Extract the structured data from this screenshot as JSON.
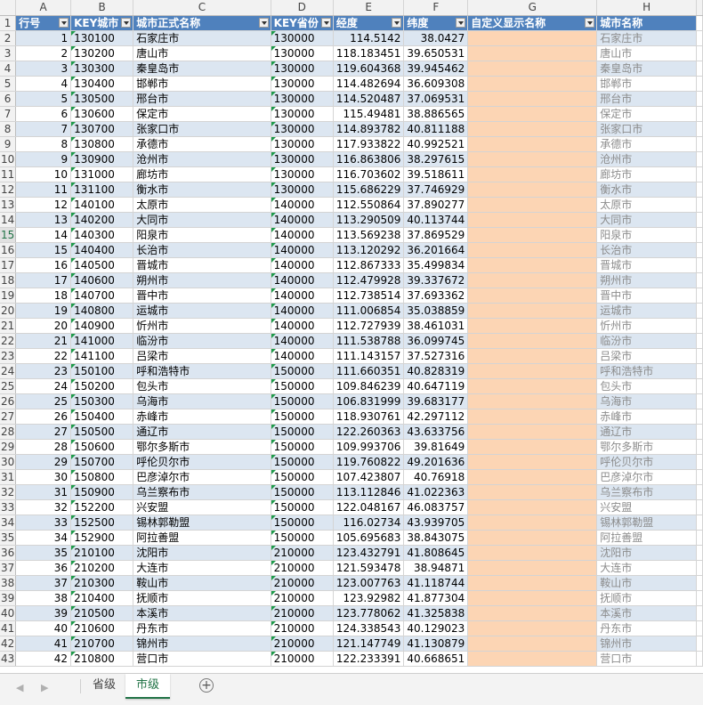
{
  "columns": [
    "A",
    "B",
    "C",
    "D",
    "E",
    "F",
    "G",
    "H"
  ],
  "headers": [
    "行号",
    "KEY城市",
    "城市正式名称",
    "KEY省份",
    "经度",
    "纬度",
    "自定义显示名称",
    "城市名称"
  ],
  "header_row_number": 1,
  "active_row_number": 15,
  "rows": [
    [
      1,
      "130100",
      "石家庄市",
      "130000",
      "114.5142",
      "38.0427",
      "",
      "石家庄市"
    ],
    [
      2,
      "130200",
      "唐山市",
      "130000",
      "118.183451",
      "39.650531",
      "",
      "唐山市"
    ],
    [
      3,
      "130300",
      "秦皇岛市",
      "130000",
      "119.604368",
      "39.945462",
      "",
      "秦皇岛市"
    ],
    [
      4,
      "130400",
      "邯郸市",
      "130000",
      "114.482694",
      "36.609308",
      "",
      "邯郸市"
    ],
    [
      5,
      "130500",
      "邢台市",
      "130000",
      "114.520487",
      "37.069531",
      "",
      "邢台市"
    ],
    [
      6,
      "130600",
      "保定市",
      "130000",
      "115.49481",
      "38.886565",
      "",
      "保定市"
    ],
    [
      7,
      "130700",
      "张家口市",
      "130000",
      "114.893782",
      "40.811188",
      "",
      "张家口市"
    ],
    [
      8,
      "130800",
      "承德市",
      "130000",
      "117.933822",
      "40.992521",
      "",
      "承德市"
    ],
    [
      9,
      "130900",
      "沧州市",
      "130000",
      "116.863806",
      "38.297615",
      "",
      "沧州市"
    ],
    [
      10,
      "131000",
      "廊坊市",
      "130000",
      "116.703602",
      "39.518611",
      "",
      "廊坊市"
    ],
    [
      11,
      "131100",
      "衡水市",
      "130000",
      "115.686229",
      "37.746929",
      "",
      "衡水市"
    ],
    [
      12,
      "140100",
      "太原市",
      "140000",
      "112.550864",
      "37.890277",
      "",
      "太原市"
    ],
    [
      13,
      "140200",
      "大同市",
      "140000",
      "113.290509",
      "40.113744",
      "",
      "大同市"
    ],
    [
      14,
      "140300",
      "阳泉市",
      "140000",
      "113.569238",
      "37.869529",
      "",
      "阳泉市"
    ],
    [
      15,
      "140400",
      "长治市",
      "140000",
      "113.120292",
      "36.201664",
      "",
      "长治市"
    ],
    [
      16,
      "140500",
      "晋城市",
      "140000",
      "112.867333",
      "35.499834",
      "",
      "晋城市"
    ],
    [
      17,
      "140600",
      "朔州市",
      "140000",
      "112.479928",
      "39.337672",
      "",
      "朔州市"
    ],
    [
      18,
      "140700",
      "晋中市",
      "140000",
      "112.738514",
      "37.693362",
      "",
      "晋中市"
    ],
    [
      19,
      "140800",
      "运城市",
      "140000",
      "111.006854",
      "35.038859",
      "",
      "运城市"
    ],
    [
      20,
      "140900",
      "忻州市",
      "140000",
      "112.727939",
      "38.461031",
      "",
      "忻州市"
    ],
    [
      21,
      "141000",
      "临汾市",
      "140000",
      "111.538788",
      "36.099745",
      "",
      "临汾市"
    ],
    [
      22,
      "141100",
      "吕梁市",
      "140000",
      "111.143157",
      "37.527316",
      "",
      "吕梁市"
    ],
    [
      23,
      "150100",
      "呼和浩特市",
      "150000",
      "111.660351",
      "40.828319",
      "",
      "呼和浩特市"
    ],
    [
      24,
      "150200",
      "包头市",
      "150000",
      "109.846239",
      "40.647119",
      "",
      "包头市"
    ],
    [
      25,
      "150300",
      "乌海市",
      "150000",
      "106.831999",
      "39.683177",
      "",
      "乌海市"
    ],
    [
      26,
      "150400",
      "赤峰市",
      "150000",
      "118.930761",
      "42.297112",
      "",
      "赤峰市"
    ],
    [
      27,
      "150500",
      "通辽市",
      "150000",
      "122.260363",
      "43.633756",
      "",
      "通辽市"
    ],
    [
      28,
      "150600",
      "鄂尔多斯市",
      "150000",
      "109.993706",
      "39.81649",
      "",
      "鄂尔多斯市"
    ],
    [
      29,
      "150700",
      "呼伦贝尔市",
      "150000",
      "119.760822",
      "49.201636",
      "",
      "呼伦贝尔市"
    ],
    [
      30,
      "150800",
      "巴彦淖尔市",
      "150000",
      "107.423807",
      "40.76918",
      "",
      "巴彦淖尔市"
    ],
    [
      31,
      "150900",
      "乌兰察布市",
      "150000",
      "113.112846",
      "41.022363",
      "",
      "乌兰察布市"
    ],
    [
      32,
      "152200",
      "兴安盟",
      "150000",
      "122.048167",
      "46.083757",
      "",
      "兴安盟"
    ],
    [
      33,
      "152500",
      "锡林郭勒盟",
      "150000",
      "116.02734",
      "43.939705",
      "",
      "锡林郭勒盟"
    ],
    [
      34,
      "152900",
      "阿拉善盟",
      "150000",
      "105.695683",
      "38.843075",
      "",
      "阿拉善盟"
    ],
    [
      35,
      "210100",
      "沈阳市",
      "210000",
      "123.432791",
      "41.808645",
      "",
      "沈阳市"
    ],
    [
      36,
      "210200",
      "大连市",
      "210000",
      "121.593478",
      "38.94871",
      "",
      "大连市"
    ],
    [
      37,
      "210300",
      "鞍山市",
      "210000",
      "123.007763",
      "41.118744",
      "",
      "鞍山市"
    ],
    [
      38,
      "210400",
      "抚顺市",
      "210000",
      "123.92982",
      "41.877304",
      "",
      "抚顺市"
    ],
    [
      39,
      "210500",
      "本溪市",
      "210000",
      "123.778062",
      "41.325838",
      "",
      "本溪市"
    ],
    [
      40,
      "210600",
      "丹东市",
      "210000",
      "124.338543",
      "40.129023",
      "",
      "丹东市"
    ],
    [
      41,
      "210700",
      "锦州市",
      "210000",
      "121.147749",
      "41.130879",
      "",
      "锦州市"
    ],
    [
      42,
      "210800",
      "营口市",
      "210000",
      "122.233391",
      "40.668651",
      "",
      "营口市"
    ]
  ],
  "sheet_tabs": [
    "省级",
    "市级"
  ],
  "active_sheet": "市级",
  "nav_prev": "◀",
  "nav_next": "▶",
  "add_sheet": "+"
}
